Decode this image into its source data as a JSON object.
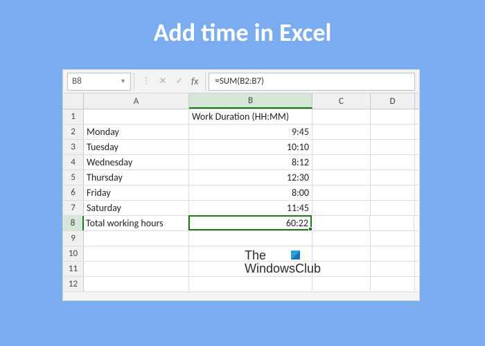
{
  "page_title": "Add time in Excel",
  "formula_bar": {
    "cell_ref": "B8",
    "formula": "=SUM(B2:B7)"
  },
  "columns": [
    "A",
    "B",
    "C",
    "D"
  ],
  "row_numbers": [
    "1",
    "2",
    "3",
    "4",
    "5",
    "6",
    "7",
    "8",
    "9",
    "10",
    "11",
    "12"
  ],
  "active_col_index": 1,
  "active_row_index": 7,
  "header_B1": "Work Duration (HH:MM)",
  "rows": [
    {
      "label": "Monday",
      "value": "9:45"
    },
    {
      "label": "Tuesday",
      "value": "10:10"
    },
    {
      "label": "Wednesday",
      "value": "8:12"
    },
    {
      "label": "Thursday",
      "value": "12:30"
    },
    {
      "label": "Friday",
      "value": "8:00"
    },
    {
      "label": "Saturday",
      "value": "11:45"
    }
  ],
  "total": {
    "label": "Total working hours",
    "value": "60:22"
  },
  "watermark": {
    "line1": "The",
    "line2": "WindowsClub"
  },
  "icons": {
    "dropdown": "▼",
    "cancel": "✕",
    "confirm": "✓",
    "fx": "fx",
    "history": "⋮"
  }
}
